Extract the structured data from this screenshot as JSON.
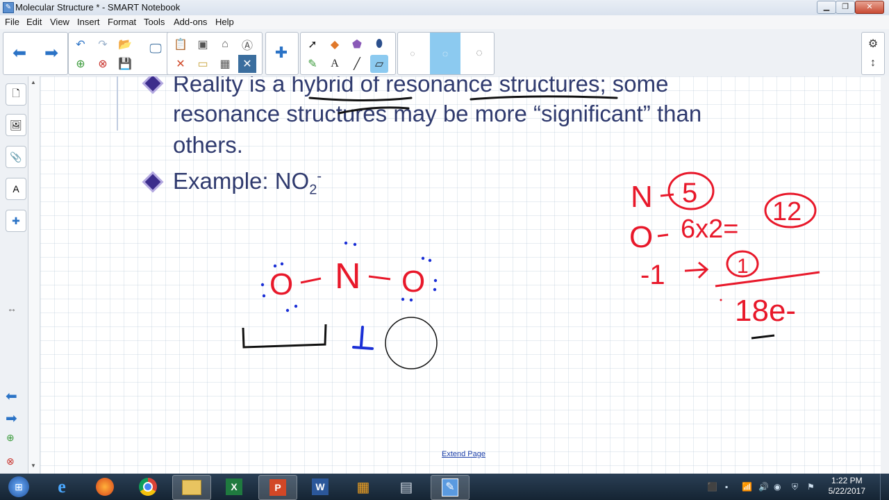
{
  "window": {
    "title": "Molecular Structure * - SMART Notebook"
  },
  "menu": [
    "File",
    "Edit",
    "View",
    "Insert",
    "Format",
    "Tools",
    "Add-ons",
    "Help"
  ],
  "slide": {
    "line1": "Reality is a hybrid of resonance structures; some",
    "line2": "resonance structures may be more “significant” than",
    "line3": "others.",
    "example_label": "Example: NO",
    "example_sub": "2",
    "example_sup": "-"
  },
  "handwriting": {
    "lewis": [
      "O",
      "N",
      "O"
    ],
    "calc": [
      "N",
      "5",
      "O",
      "6x2=",
      "12",
      "-1",
      "1",
      "18e-"
    ]
  },
  "extend_page": "Extend Page",
  "clock": {
    "time": "1:22 PM",
    "date": "5/22/2017"
  },
  "colors": {
    "ink_red": "#e8182a",
    "ink_blue": "#1a2fd6",
    "text": "#2f3a6e"
  },
  "icons": [
    "back-arrow-icon",
    "forward-arrow-icon",
    "undo-icon",
    "redo-icon",
    "open-icon",
    "save-icon",
    "screen-shade-icon",
    "paste-icon",
    "screen-capture-icon",
    "table-icon",
    "select-icon",
    "pen-icon",
    "eraser-icon",
    "line-icon",
    "text-icon",
    "settings-icon"
  ]
}
